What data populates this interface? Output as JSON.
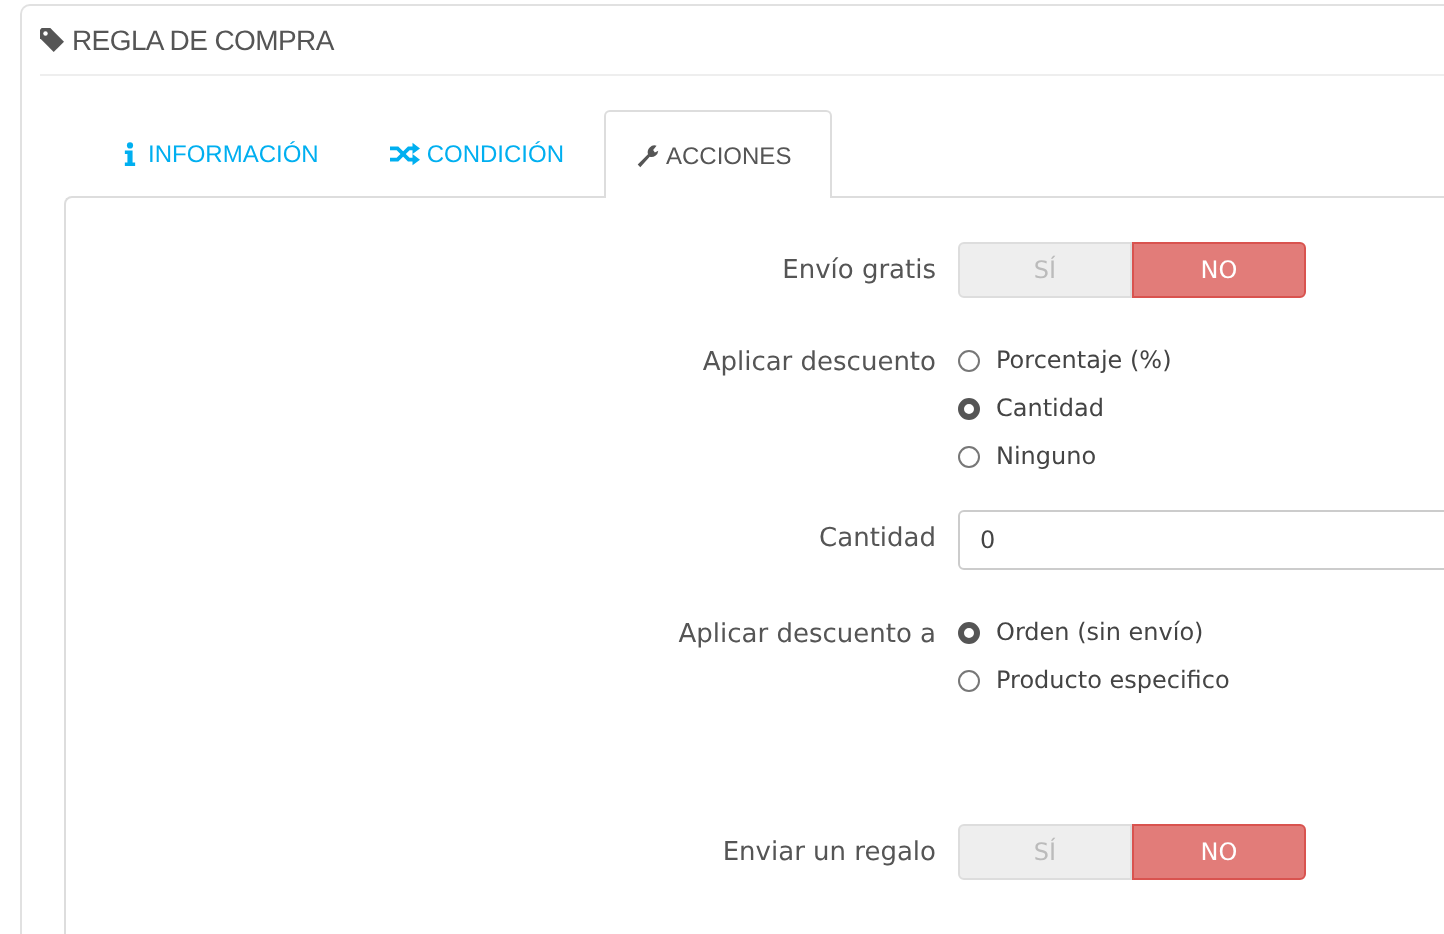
{
  "panel": {
    "title": "REGLA DE COMPRA"
  },
  "tabs": [
    {
      "label": "INFORMACIÓN",
      "kind": "info",
      "selected": false
    },
    {
      "label": "CONDICIÓN",
      "kind": "condition",
      "selected": false
    },
    {
      "label": "ACCIONES",
      "kind": "actions",
      "selected": true
    }
  ],
  "fields": [
    {
      "kind": "toggle",
      "label": "Envío gratis",
      "options": [
        {
          "label": "SÍ",
          "selected": false
        },
        {
          "label": "NO",
          "selected": true
        }
      ]
    },
    {
      "kind": "radio",
      "label": "Aplicar descuento",
      "options": [
        {
          "label": "Porcentaje (%)",
          "selected": false
        },
        {
          "label": "Cantidad",
          "selected": true
        },
        {
          "label": "Ninguno",
          "selected": false
        }
      ]
    },
    {
      "kind": "text",
      "label": "Cantidad",
      "value": "0"
    },
    {
      "kind": "radio",
      "label": "Aplicar descuento a",
      "options": [
        {
          "label": "Orden (sin envío)",
          "selected": true
        },
        {
          "label": "Producto especifico",
          "selected": false
        }
      ]
    },
    {
      "kind": "spacer"
    },
    {
      "kind": "toggle",
      "label": "Enviar un regalo",
      "options": [
        {
          "label": "SÍ",
          "selected": false
        },
        {
          "label": "NO",
          "selected": true
        }
      ]
    }
  ]
}
